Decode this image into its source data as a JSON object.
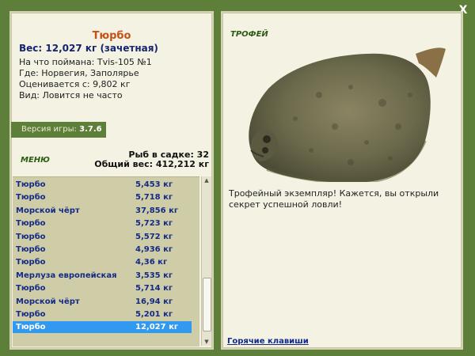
{
  "window": {
    "close_label": "X"
  },
  "fish": {
    "name": "Тюрбо",
    "weight_line": "Вес: 12,027 кг (зачетная)",
    "caught_on": "На что поймана: Tvis-105 №1",
    "location": "Где: Норвегия, Заполярье",
    "value": "Оценивается с: 9,802 кг",
    "frequency": "Вид: Ловится не часто"
  },
  "version": {
    "label": "Версия игры:",
    "number": "3.7.6"
  },
  "menu": {
    "label": "МЕНЮ"
  },
  "stats": {
    "fish_count": "Рыб в садке: 32",
    "total_weight": "Общий вес: 412,212 кг"
  },
  "catch_list": [
    {
      "name": "Тюрбо",
      "weight": "5,453 кг"
    },
    {
      "name": "Тюрбо",
      "weight": "5,718 кг"
    },
    {
      "name": "Морской чёрт",
      "weight": "37,856 кг"
    },
    {
      "name": "Тюрбо",
      "weight": "5,723 кг"
    },
    {
      "name": "Тюрбо",
      "weight": "5,572 кг"
    },
    {
      "name": "Тюрбо",
      "weight": "4,936 кг"
    },
    {
      "name": "Тюрбо",
      "weight": "4,36 кг"
    },
    {
      "name": "Мерлуза европейская",
      "weight": "3,535 кг"
    },
    {
      "name": "Тюрбо",
      "weight": "5,714 кг"
    },
    {
      "name": "Морской чёрт",
      "weight": "16,94 кг"
    },
    {
      "name": "Тюрбо",
      "weight": "5,201 кг"
    },
    {
      "name": "Тюрбо",
      "weight": "12,027 кг",
      "selected": true
    }
  ],
  "trophy": {
    "label": "ТРОФЕЙ",
    "text": "Трофейный экземпляр! Кажется, вы открыли секрет успешной ловли!",
    "hotkeys_link": "Горячие клавиши"
  },
  "colors": {
    "frame_green": "#5e7f39",
    "panel_bg": "#f4f2e2",
    "title_orange": "#c6501a",
    "list_text_blue": "#142a86",
    "selection_blue": "#3199f0"
  }
}
